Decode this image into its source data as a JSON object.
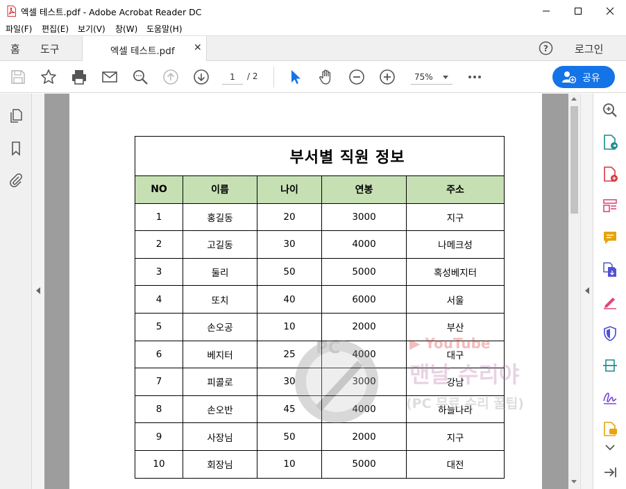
{
  "window": {
    "title": "엑셀 테스트.pdf - Adobe Acrobat Reader DC"
  },
  "menu": {
    "items": [
      "파일(F)",
      "편집(E)",
      "보기(V)",
      "창(W)",
      "도움말(H)"
    ]
  },
  "tabs": {
    "home": "홈",
    "tools": "도구",
    "document": "엑셀 테스트.pdf",
    "login": "로그인"
  },
  "toolbar": {
    "page_current": "1",
    "page_total": "/ 2",
    "zoom": "75%",
    "share_label": "공유"
  },
  "table": {
    "title": "부서별 직원 정보",
    "headers": [
      "NO",
      "이름",
      "나이",
      "연봉",
      "주소"
    ],
    "rows": [
      [
        "1",
        "홍길동",
        "20",
        "3000",
        "지구"
      ],
      [
        "2",
        "고길동",
        "30",
        "4000",
        "나메크성"
      ],
      [
        "3",
        "둘리",
        "50",
        "5000",
        "혹성베지터"
      ],
      [
        "4",
        "또치",
        "40",
        "6000",
        "서울"
      ],
      [
        "5",
        "손오공",
        "10",
        "2000",
        "부산"
      ],
      [
        "6",
        "베지터",
        "25",
        "4000",
        "대구"
      ],
      [
        "7",
        "피콜로",
        "30",
        "3000",
        "강남"
      ],
      [
        "8",
        "손오반",
        "45",
        "4000",
        "하늘나라"
      ],
      [
        "9",
        "사장님",
        "50",
        "2000",
        "지구"
      ],
      [
        "10",
        "회장님",
        "10",
        "5000",
        "대전"
      ]
    ]
  },
  "watermark": {
    "badge": "PC",
    "youtube": "▶ YouTube",
    "name": "맨날 수리야",
    "subtitle": "(PC 무료 수리 꿀팁)"
  },
  "colors": {
    "accent": "#1473e6",
    "header_fill": "#c6e0b4",
    "viewer_bg": "#9d9d9d"
  }
}
